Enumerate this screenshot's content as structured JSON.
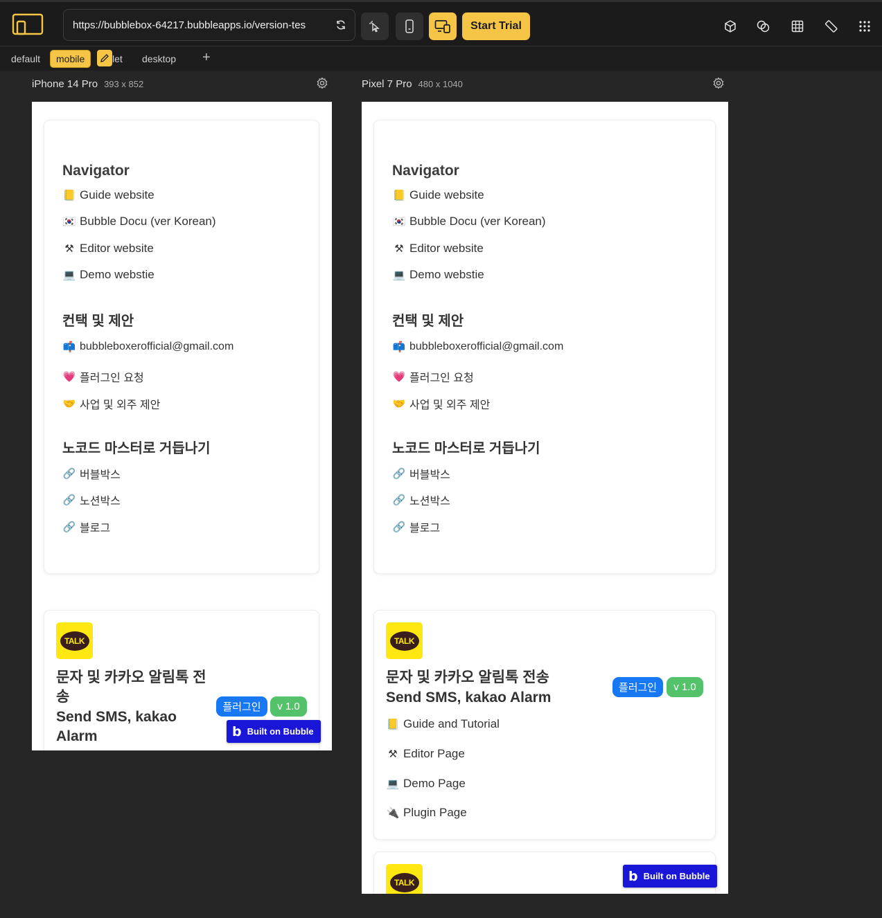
{
  "toolbar": {
    "url": "https://bubblebox-64217.bubbleapps.io/version-tes",
    "start_trial_label": "Start Trial",
    "icons": [
      "logo-icon",
      "reload-icon",
      "cursor-icon",
      "phone-icon",
      "responsive-icon",
      "cube-icon",
      "overlap-icon",
      "grid-icon",
      "ruler-icon",
      "apps-grid-icon"
    ]
  },
  "breakpoints": {
    "items": [
      "default",
      "mobile",
      "let",
      "desktop"
    ],
    "active": "mobile",
    "add_label": "+"
  },
  "devices": [
    {
      "name": "iPhone 14 Pro",
      "dims": "393 x 852"
    },
    {
      "name": "Pixel 7 Pro",
      "dims": "480 x 1040"
    }
  ],
  "navigator": {
    "title": "Navigator",
    "links": [
      {
        "emoji": "📒",
        "label": "Guide website"
      },
      {
        "emoji": "🇰🇷",
        "label": "Bubble Docu (ver Korean)"
      },
      {
        "emoji": "⚒",
        "label": "Editor website"
      },
      {
        "emoji": "💻",
        "label": "Demo webstie"
      }
    ],
    "contact_title": "컨택 및 제안",
    "contact": [
      {
        "emoji": "📫",
        "label": "bubbleboxerofficial@gmail.com"
      },
      {
        "emoji": "💗",
        "label": "플러그인 요청"
      },
      {
        "emoji": "🤝",
        "label": "사업 및 외주 제안"
      }
    ],
    "master_title": "노코드 마스터로 거듭나기",
    "master": [
      {
        "emoji": "🔗",
        "label": "버블박스"
      },
      {
        "emoji": "🔗",
        "label": "노션박스"
      },
      {
        "emoji": "🔗",
        "label": "블로그"
      }
    ]
  },
  "plugin": {
    "talk": "TALK",
    "title_ko_phone": [
      "문자 및 카카오 알림톡 전",
      "송"
    ],
    "title_en_phone": [
      "Send SMS, kakao",
      "Alarm"
    ],
    "title_ko": "문자 및 카카오 알림톡 전송",
    "title_en": "Send SMS, kakao Alarm",
    "badge_plugin": "플러그인",
    "badge_version": "v 1.0",
    "links": [
      {
        "emoji": "📒",
        "label": "Guide and Tutorial"
      },
      {
        "emoji": "⚒",
        "label": "Editor Page"
      },
      {
        "emoji": "💻",
        "label": "Demo Page"
      },
      {
        "emoji": "🔌",
        "label": "Plugin Page"
      }
    ]
  },
  "built_on_bubble": "Built on Bubble",
  "colors": {
    "accent": "#f6c545",
    "badge_blue": "#1877f2",
    "badge_green": "#54c26a",
    "bubble_blue": "#1a16d8",
    "kakao_yellow": "#ffe812"
  }
}
